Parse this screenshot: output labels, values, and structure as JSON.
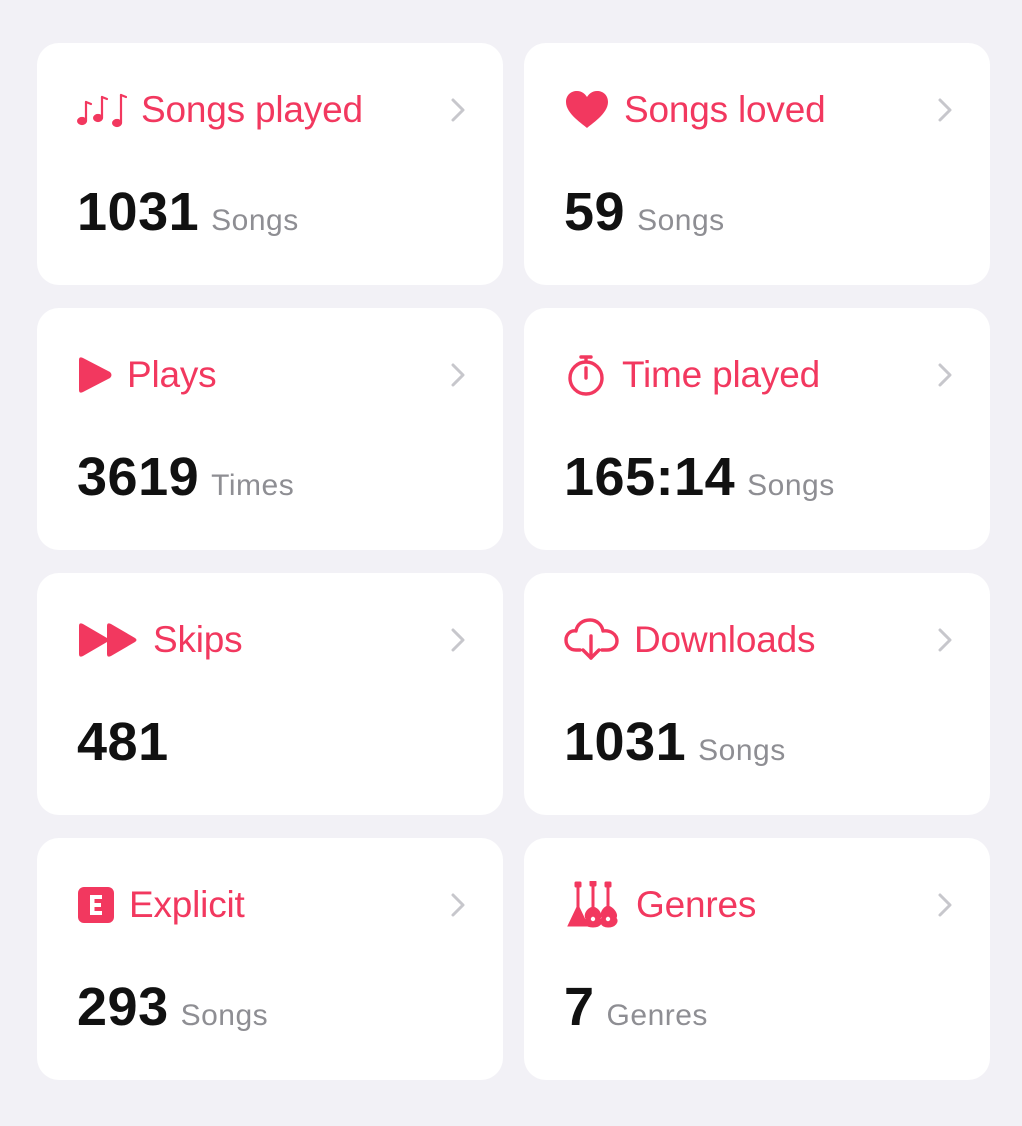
{
  "colors": {
    "background": "#f2f1f6",
    "card": "#ffffff",
    "accent": "#f2385f",
    "value_text": "#111111",
    "unit_text": "#8e8e93",
    "chevron": "#c7c7cc"
  },
  "cards": [
    {
      "key": "songs-played",
      "icon": "music-notes-icon",
      "title": "Songs played",
      "value": "1031",
      "unit": "Songs"
    },
    {
      "key": "songs-loved",
      "icon": "heart-icon",
      "title": "Songs loved",
      "value": "59",
      "unit": "Songs"
    },
    {
      "key": "plays",
      "icon": "play-icon",
      "title": "Plays",
      "value": "3619",
      "unit": "Times"
    },
    {
      "key": "time-played",
      "icon": "stopwatch-icon",
      "title": "Time played",
      "value": "165:14",
      "unit": "Songs"
    },
    {
      "key": "skips",
      "icon": "fast-forward-icon",
      "title": "Skips",
      "value": "481",
      "unit": ""
    },
    {
      "key": "downloads",
      "icon": "cloud-download-icon",
      "title": "Downloads",
      "value": "1031",
      "unit": "Songs"
    },
    {
      "key": "explicit",
      "icon": "explicit-badge-icon",
      "title": "Explicit",
      "value": "293",
      "unit": "Songs"
    },
    {
      "key": "genres",
      "icon": "guitars-icon",
      "title": "Genres",
      "value": "7",
      "unit": "Genres"
    }
  ]
}
